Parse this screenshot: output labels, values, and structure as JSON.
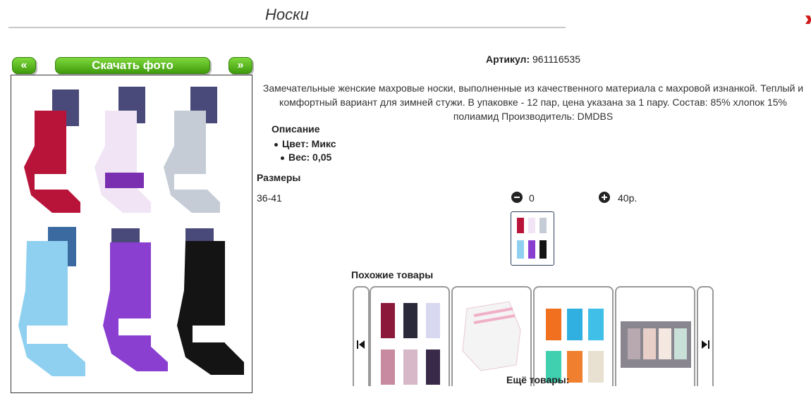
{
  "page": {
    "title": "Носки"
  },
  "nav": {
    "prev": "«",
    "next": "»",
    "download": "Скачать фото"
  },
  "product": {
    "sku_label": "Артикул:",
    "sku_value": "961116535",
    "description": "Замечательные женские махровые носки, выполненные из качественного материала с махровой изнанкой. Теплый и комфортный вариант для зимней стужи. В упаковке - 12 пар, цена указана за 1 пару. Состав: 85% хлопок 15% полиамид Производитель: DMDBS",
    "desc_heading": "Описание",
    "color": "Цвет: Микс",
    "weight": "Вес: 0,05",
    "sizes_heading": "Размеры",
    "size": "36-41",
    "quantity": "0",
    "price": "40р."
  },
  "similar": {
    "heading": "Похожие товары",
    "more": "Ещё товары:"
  },
  "colors": {
    "button_green": "#4fb01a",
    "sock_colors": [
      "#b8143a",
      "#f0e4f5",
      "#c6ccd6",
      "#8fd0f0",
      "#8a3fd0",
      "#141414"
    ]
  }
}
